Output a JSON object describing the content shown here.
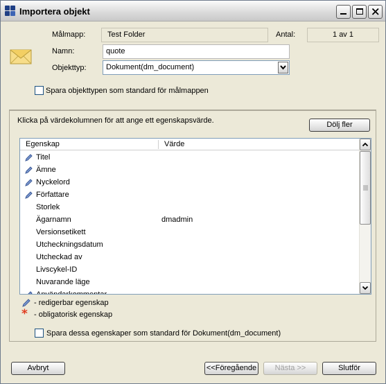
{
  "window": {
    "title": "Importera objekt"
  },
  "form": {
    "target_folder_label": "Målmapp:",
    "target_folder_value": "Test Folder",
    "count_label": "Antal:",
    "count_value": "1 av 1",
    "name_label": "Namn:",
    "name_value": "quote",
    "type_label": "Objekttyp:",
    "type_value": "Dokument(dm_document)",
    "save_type_default_label": "Spara objekttypen som standard för målmappen",
    "save_type_default_checked": false
  },
  "properties": {
    "instruction": "Klicka på värdekolumnen för att ange ett egenskapsvärde.",
    "hide_more_button": "Dölj fler",
    "columns": {
      "property": "Egenskap",
      "value": "Värde"
    },
    "rows": [
      {
        "name": "Titel",
        "value": "",
        "editable": true
      },
      {
        "name": "Ämne",
        "value": "",
        "editable": true
      },
      {
        "name": "Nyckelord",
        "value": "",
        "editable": true
      },
      {
        "name": "Författare",
        "value": "",
        "editable": true
      },
      {
        "name": "Storlek",
        "value": "",
        "editable": false
      },
      {
        "name": "Ägarnamn",
        "value": "dmadmin",
        "editable": false
      },
      {
        "name": "Versionsetikett",
        "value": "",
        "editable": false
      },
      {
        "name": "Utcheckningsdatum",
        "value": "",
        "editable": false
      },
      {
        "name": "Utcheckad av",
        "value": "",
        "editable": false
      },
      {
        "name": "Livscykel-ID",
        "value": "",
        "editable": false
      },
      {
        "name": "Nuvarande läge",
        "value": "",
        "editable": false
      },
      {
        "name": "Användarkommentar",
        "value": "",
        "editable": true
      }
    ],
    "legend_editable": "- redigerbar egenskap",
    "legend_required": "- obligatorisk egenskap",
    "save_props_default_label": "Spara dessa egenskaper som standard för Dokument(dm_document)",
    "save_props_default_checked": false
  },
  "buttons": {
    "cancel": "Avbryt",
    "previous": "<<Föregående",
    "next": "Nästa >>",
    "finish": "Slutför"
  },
  "icons": {
    "app": "app-logo-icon",
    "envelope": "envelope-icon",
    "pencil": "pencil-icon",
    "required": "asterisk-icon"
  },
  "colors": {
    "dialog_bg": "#ece9d8",
    "required": "#e03a1e",
    "pencil": "#4a6fb0"
  }
}
